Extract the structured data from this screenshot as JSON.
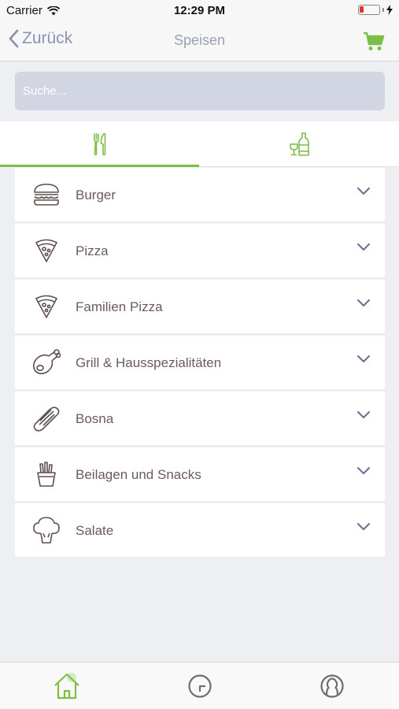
{
  "status_bar": {
    "carrier": "Carrier",
    "time": "12:29 PM"
  },
  "nav": {
    "back_label": "Zurück",
    "title": "Speisen"
  },
  "search": {
    "placeholder": "Suche..."
  },
  "tabs": [
    {
      "icon": "fork-knife-icon",
      "active": true
    },
    {
      "icon": "wine-bottle-glass-icon",
      "active": false
    }
  ],
  "categories": [
    {
      "label": "Burger",
      "icon": "burger-icon"
    },
    {
      "label": "Pizza",
      "icon": "pizza-slice-icon"
    },
    {
      "label": "Familien Pizza",
      "icon": "pizza-slice-icon"
    },
    {
      "label": "Grill & Hausspezialitäten",
      "icon": "chicken-leg-icon"
    },
    {
      "label": "Bosna",
      "icon": "hotdog-icon"
    },
    {
      "label": "Beilagen und Snacks",
      "icon": "fries-icon"
    },
    {
      "label": "Salate",
      "icon": "broccoli-icon"
    }
  ],
  "tab_bar": [
    {
      "icon": "home-icon",
      "active": true
    },
    {
      "icon": "clock-icon",
      "active": false
    },
    {
      "icon": "profile-icon",
      "active": false
    }
  ],
  "colors": {
    "accent": "#7bbf44",
    "nav_text": "#8d93b4",
    "label_text": "#6b5b5b",
    "search_bg": "#d1d6e2"
  }
}
